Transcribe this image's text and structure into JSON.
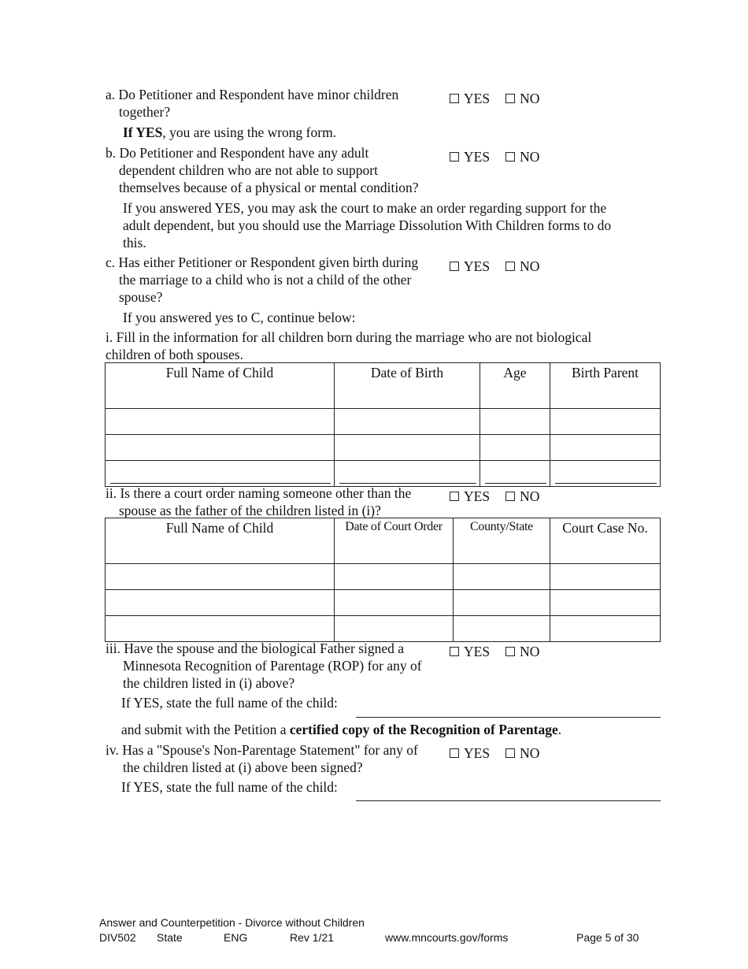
{
  "questions": {
    "a": {
      "lines": [
        "a. Do Petitioner and Respondent have minor children",
        "together?"
      ],
      "note_bold": "If YES",
      "note_rest": ", you are using the wrong form."
    },
    "b": {
      "lines": [
        "b. Do Petitioner and Respondent have any adult",
        "dependent children who are not able to support",
        "themselves because of a physical or mental condition?"
      ],
      "note_lines": [
        "If you answered YES, you may ask the court to make an order regarding support for the",
        "adult dependent, but you should use the Marriage Dissolution With Children forms to do",
        "this."
      ]
    },
    "c": {
      "lines": [
        "c. Has either Petitioner or Respondent given birth during",
        "the marriage to a child who is not a child of the other",
        "spouse?"
      ],
      "note": "If you answered yes to C, continue below:"
    },
    "i": {
      "lines": [
        "i. Fill in the information for all children born during the marriage who are not biological",
        "children of both spouses."
      ]
    },
    "ii": {
      "lines": [
        "ii. Is there a court order naming someone other than the",
        "spouse as the father of the children listed in (i)?"
      ]
    },
    "iii": {
      "lines": [
        "iii. Have the spouse and the biological Father signed a",
        "Minnesota Recognition of Parentage (ROP) for any of",
        "the children listed in (i) above?"
      ],
      "child_label": "If YES, state the full name of the child:",
      "submit_prefix": "and submit with the Petition a ",
      "submit_bold": "certified copy of the Recognition of Parentage",
      "submit_suffix": "."
    },
    "iv": {
      "lines": [
        "iv. Has a \"Spouse's Non-Parentage Statement\" for any of",
        "the children listed at (i) above been signed?"
      ],
      "child_label": "If YES, state the full name of the child:"
    }
  },
  "options": {
    "yes": "YES",
    "no": "NO"
  },
  "table1": {
    "headers": [
      "Full Name of Child",
      "Date of Birth",
      "Age",
      "Birth Parent"
    ],
    "rows": [
      [
        "",
        "",
        "",
        ""
      ],
      [
        "",
        "",
        "",
        ""
      ],
      [
        "",
        "",
        "",
        ""
      ]
    ]
  },
  "table2": {
    "headers": [
      "Full Name of Child",
      "Date of Court Order",
      "County/State",
      "Court Case No."
    ],
    "rows": [
      [
        "",
        "",
        "",
        ""
      ],
      [
        "",
        "",
        "",
        ""
      ],
      [
        "",
        "",
        "",
        ""
      ]
    ]
  },
  "footer": {
    "title": "Answer and Counterpetition - Divorce without Children",
    "form_id": "DIV502",
    "jurisdiction": "State",
    "language": "ENG",
    "revision": "Rev 1/21",
    "url": "www.mncourts.gov/forms",
    "page": "Page 5 of 30"
  }
}
